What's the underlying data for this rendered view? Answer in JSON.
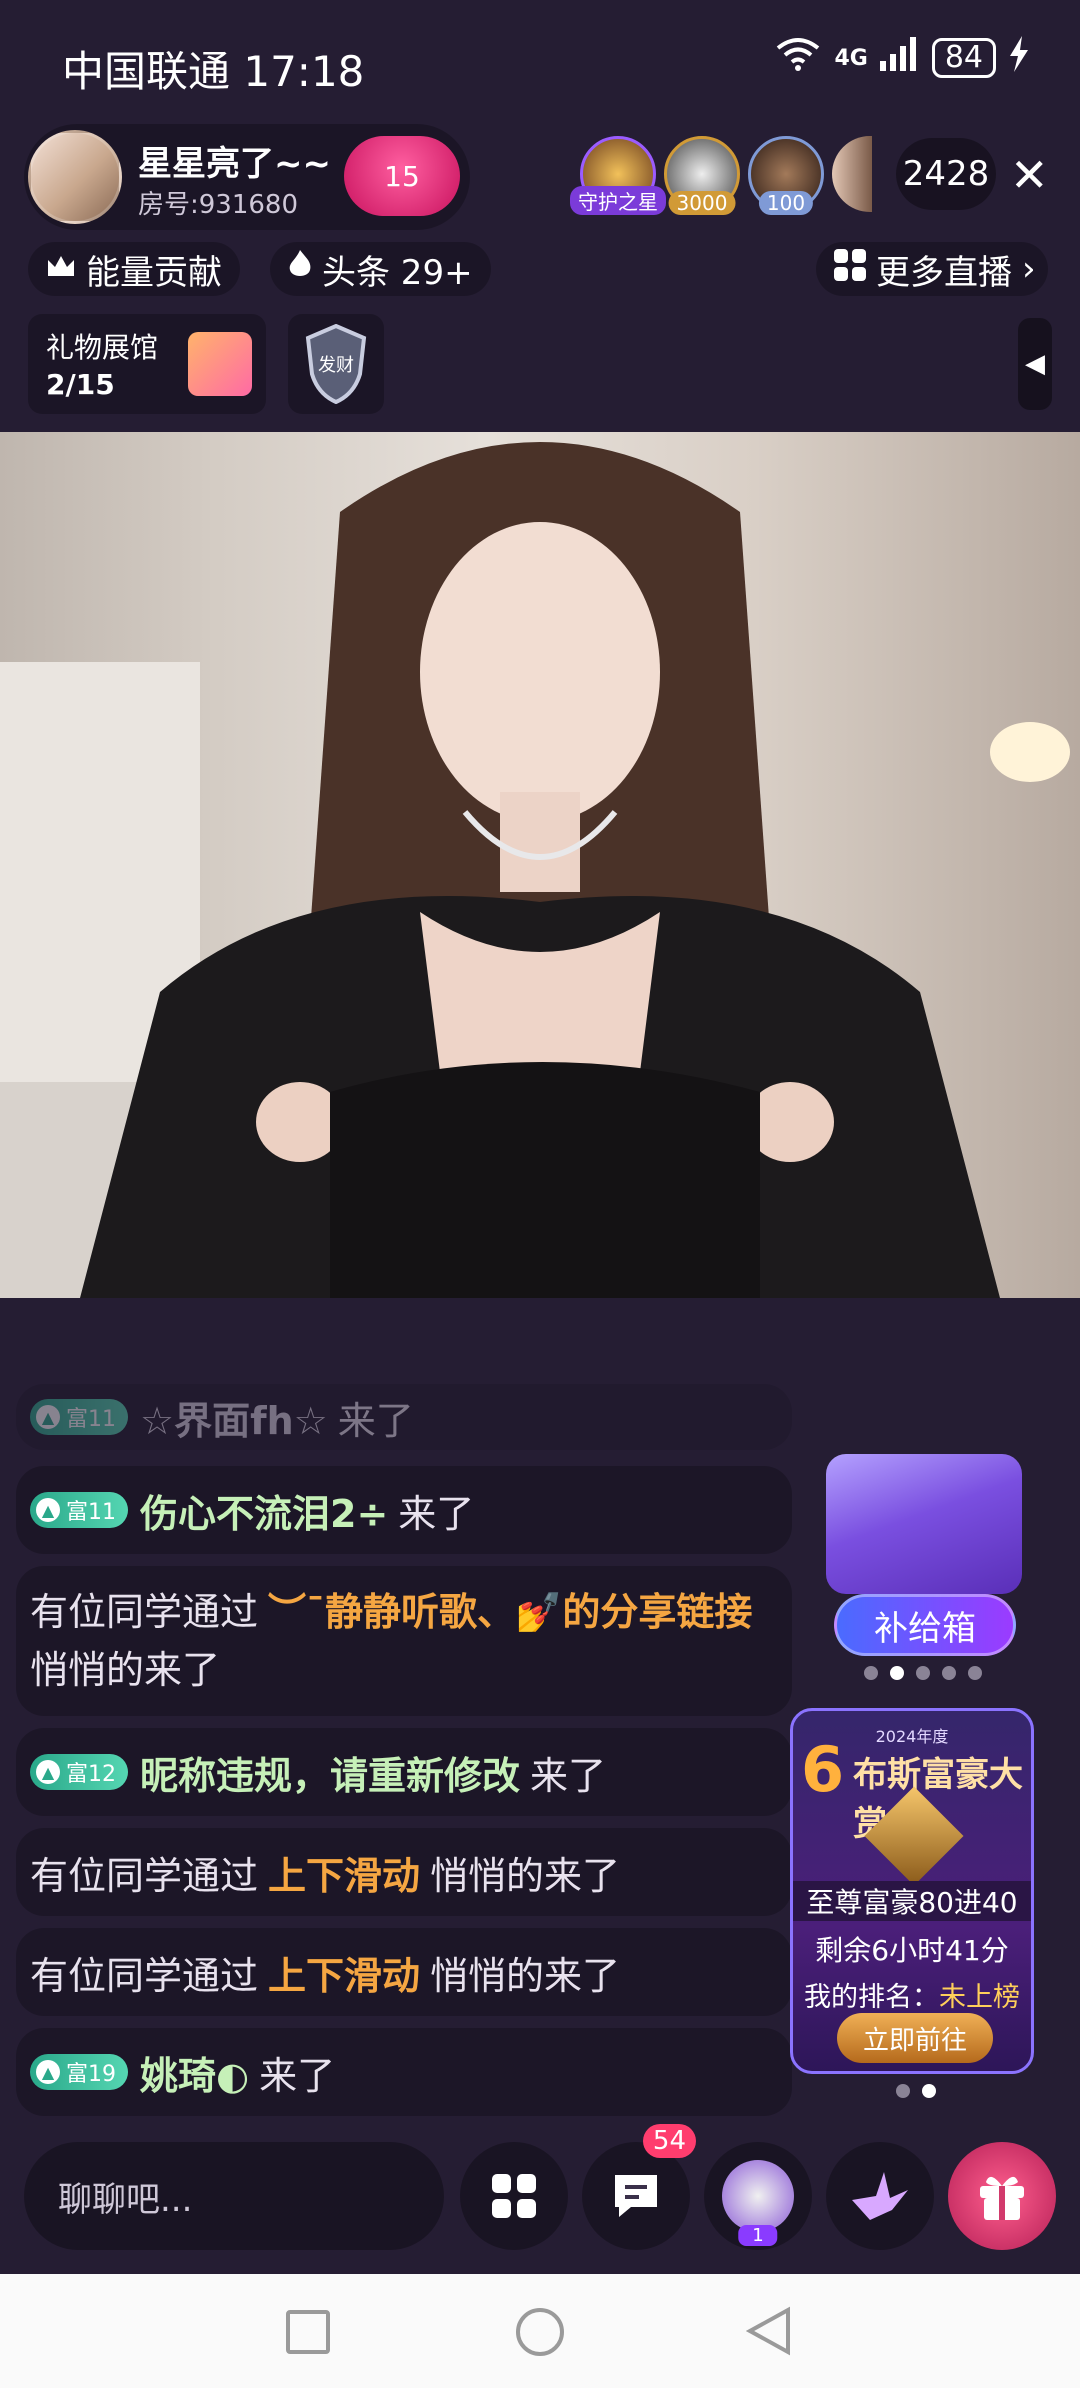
{
  "status_bar": {
    "carrier_time": "中国联通 17:18",
    "network": "4G",
    "battery": "84"
  },
  "host": {
    "name": "星星亮了~~",
    "room": "房号:931680",
    "heart_level": "15"
  },
  "guards": [
    {
      "tag": "守护之星",
      "color": "#7b3bd9"
    },
    {
      "tag": "3000",
      "color": "#d19a36"
    },
    {
      "tag": "100",
      "color": "#7f9ad6"
    }
  ],
  "viewer_count": "2428",
  "tags": {
    "energy": "能量贡献",
    "headline": "头条 29+",
    "more_live": "更多直播"
  },
  "gift_gallery": {
    "title": "礼物展馆",
    "progress": "2/15"
  },
  "shield_label": "发财",
  "chat": {
    "msg0": {
      "level": "富11",
      "name": "☆界面fh☆",
      "suffix": "来了"
    },
    "msg1": {
      "level": "富11",
      "name": "伤心不流泪2÷",
      "suffix": "来了"
    },
    "msg2": {
      "prefix": "有位同学通过",
      "highlight": "︶ˉ静静听歌、💅的分享链接",
      "suffix": "悄悄的来了"
    },
    "msg3": {
      "level": "富12",
      "name": "昵称违规，请重新修改",
      "suffix": "来了"
    },
    "msg4": {
      "prefix": "有位同学通过",
      "highlight": "上下滑动",
      "suffix": "悄悄的来了"
    },
    "msg5": {
      "prefix": "有位同学通过",
      "highlight": "上下滑动",
      "suffix": "悄悄的来了"
    },
    "msg6": {
      "level": "富19",
      "name": "姚琦◐",
      "suffix": "来了"
    }
  },
  "supply_box": {
    "label": "补给箱"
  },
  "rank_banner": {
    "year": "2024年度",
    "six": "6",
    "title": "布斯富豪大赏",
    "line1": "至尊富豪80进40",
    "line2": "剩余6小时41分",
    "my_rank_label": "我的排名：",
    "my_rank_value": "未上榜",
    "go": "立即前往"
  },
  "bottom": {
    "input_placeholder": "聊聊吧...",
    "msg_badge": "54",
    "seat_badge": "1"
  }
}
